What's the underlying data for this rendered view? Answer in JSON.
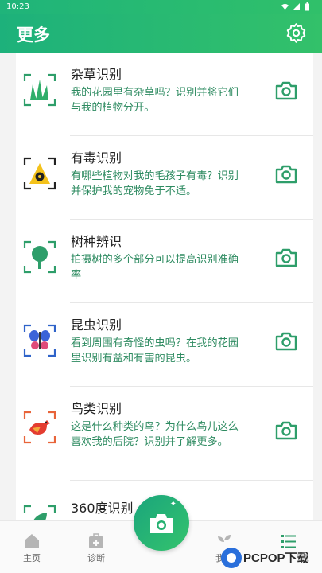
{
  "status_bar": {
    "time": "10:23"
  },
  "app_bar": {
    "title": "更多"
  },
  "features": [
    {
      "title": "杂草识别",
      "description": "我的花园里有杂草吗？识别并将它们与我的植物分开。"
    },
    {
      "title": "有毒识别",
      "description": "有哪些植物对我的毛孩子有毒？识别并保护我的宠物免于不适。"
    },
    {
      "title": "树种辨识",
      "description": "拍摄树的多个部分可以提高识别准确率"
    },
    {
      "title": "昆虫识别",
      "description": "看到周围有奇怪的虫吗？在我的花园里识别有益和有害的昆虫。"
    },
    {
      "title": "鸟类识别",
      "description": "这是什么种类的鸟？为什么鸟儿这么喜欢我的后院？识别并了解更多。"
    },
    {
      "title": "360度识别",
      "description": ""
    }
  ],
  "bottom_nav": [
    {
      "label": "主页"
    },
    {
      "label": "诊断"
    },
    {
      "label": "我的"
    },
    {
      "label": ""
    }
  ],
  "watermark": {
    "text": "PCPOP下载"
  },
  "colors": {
    "accent": "#1db17b",
    "text_green": "#2e8b61"
  }
}
